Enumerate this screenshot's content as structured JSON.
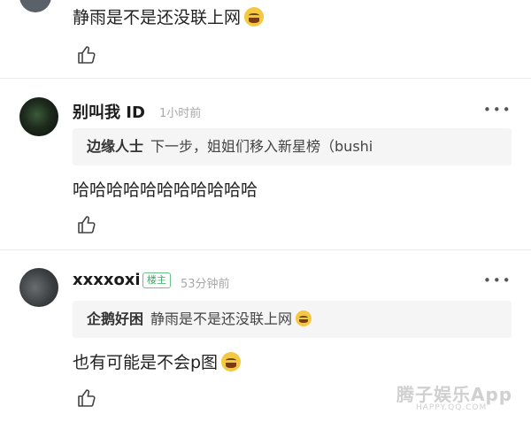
{
  "comments": [
    {
      "text": "静雨是不是还没联上网",
      "emoji": "laugh-cry-emoji"
    },
    {
      "user": "别叫我 ID",
      "time": "1小时前",
      "more": "•••",
      "quote": {
        "name": "边缘人士",
        "text": "下一步，姐姐们移入新星榜（bushi"
      },
      "text": "哈哈哈哈哈哈哈哈哈哈哈"
    },
    {
      "user": "xxxxoxi",
      "badge": "楼主",
      "time": "53分钟前",
      "more": "•••",
      "quote": {
        "name": "企鹅好困",
        "text": "静雨是不是还没联上网"
      },
      "text": "也有可能是不会p图"
    }
  ],
  "watermark": {
    "main": "腾子娱乐App",
    "sub": "HAPPY.QQ.COM"
  },
  "colors": {
    "badge_green": "#3ea869",
    "quote_bg": "#f5f5f5",
    "divider": "#ececec"
  }
}
